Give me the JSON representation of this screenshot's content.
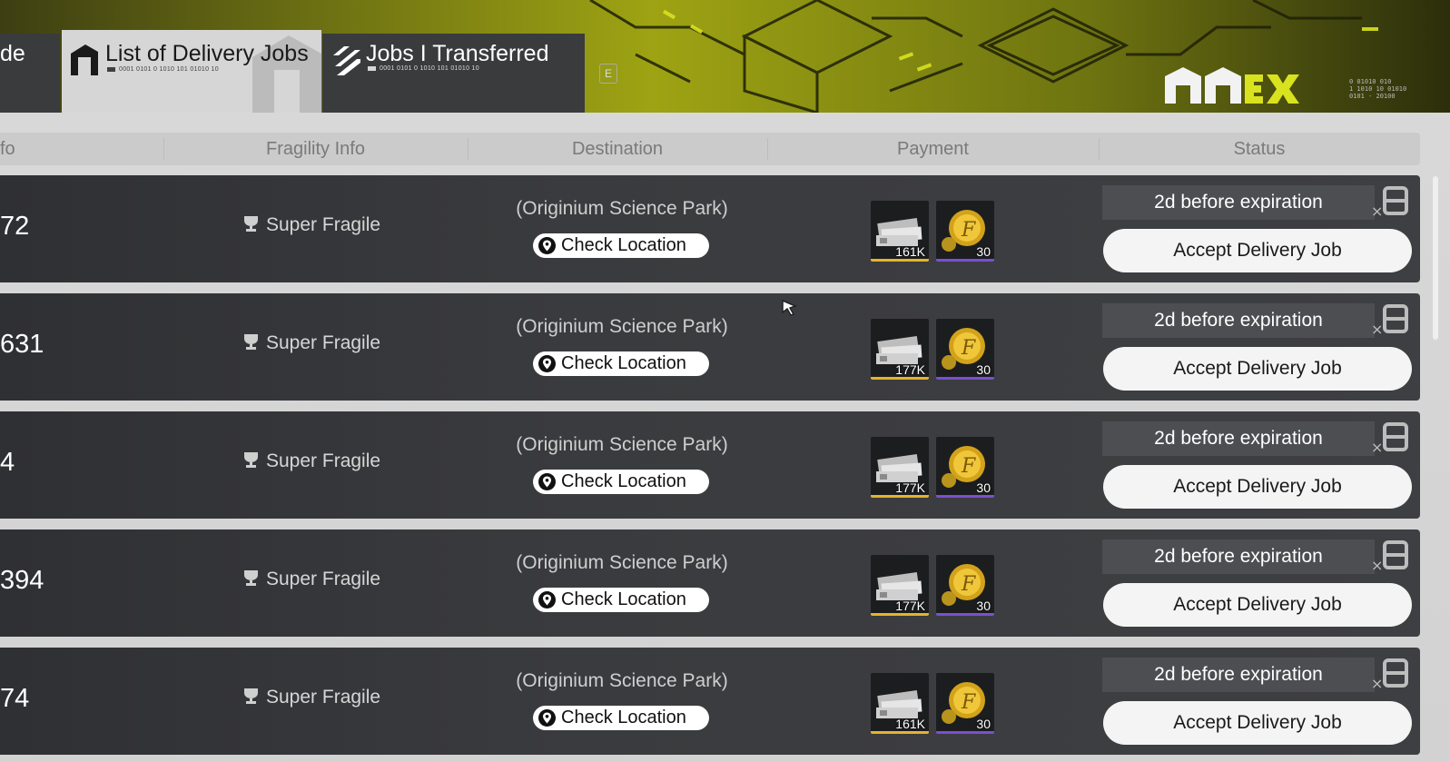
{
  "tabs": [
    {
      "label": "de",
      "code": ""
    },
    {
      "label": "List of Delivery Jobs",
      "code": "0001 0101 0 1010 101 01010 10"
    },
    {
      "label": "Jobs I Transferred",
      "code": "0001 0101 0 1010 101 01010 10"
    }
  ],
  "key_hint": "E",
  "brand": {
    "code_line1": "0 01010 010",
    "code_line2": "1 1010 10 01010",
    "code_line3": "0101 - 20100"
  },
  "columns": [
    "fo",
    "Fragility Info",
    "Destination",
    "Payment",
    "Status"
  ],
  "rows": [
    {
      "id": "72",
      "fragility": "Super Fragile",
      "destination": "(Originium Science Park)",
      "check_label": "Check Location",
      "money": "161K",
      "coins": "30",
      "expiry": "2d before expiration",
      "accept_label": "Accept Delivery Job"
    },
    {
      "id": "631",
      "fragility": "Super Fragile",
      "destination": "(Originium Science Park)",
      "check_label": "Check Location",
      "money": "177K",
      "coins": "30",
      "expiry": "2d before expiration",
      "accept_label": "Accept Delivery Job"
    },
    {
      "id": "4",
      "fragility": "Super Fragile",
      "destination": "(Originium Science Park)",
      "check_label": "Check Location",
      "money": "177K",
      "coins": "30",
      "expiry": "2d before expiration",
      "accept_label": "Accept Delivery Job"
    },
    {
      "id": "394",
      "fragility": "Super Fragile",
      "destination": "(Originium Science Park)",
      "check_label": "Check Location",
      "money": "177K",
      "coins": "30",
      "expiry": "2d before expiration",
      "accept_label": "Accept Delivery Job"
    },
    {
      "id": "74",
      "fragility": "Super Fragile",
      "destination": "(Originium Science Park)",
      "check_label": "Check Location",
      "money": "161K",
      "coins": "30",
      "expiry": "2d before expiration",
      "accept_label": "Accept Delivery Job"
    }
  ],
  "icons": {
    "tab_list": "warehouse-icon",
    "tab_transferred": "transfer-icon",
    "fragility": "trophy-cup-icon",
    "location": "map-pin-icon",
    "money": "banknotes-icon",
    "coin": "gold-coin-icon",
    "discard": "discard-job-icon"
  },
  "colors": {
    "accent": "#d9e21e",
    "panel": "#3a3b3e",
    "money_border": "#e4b52a",
    "coin_border": "#7b4fd1"
  }
}
